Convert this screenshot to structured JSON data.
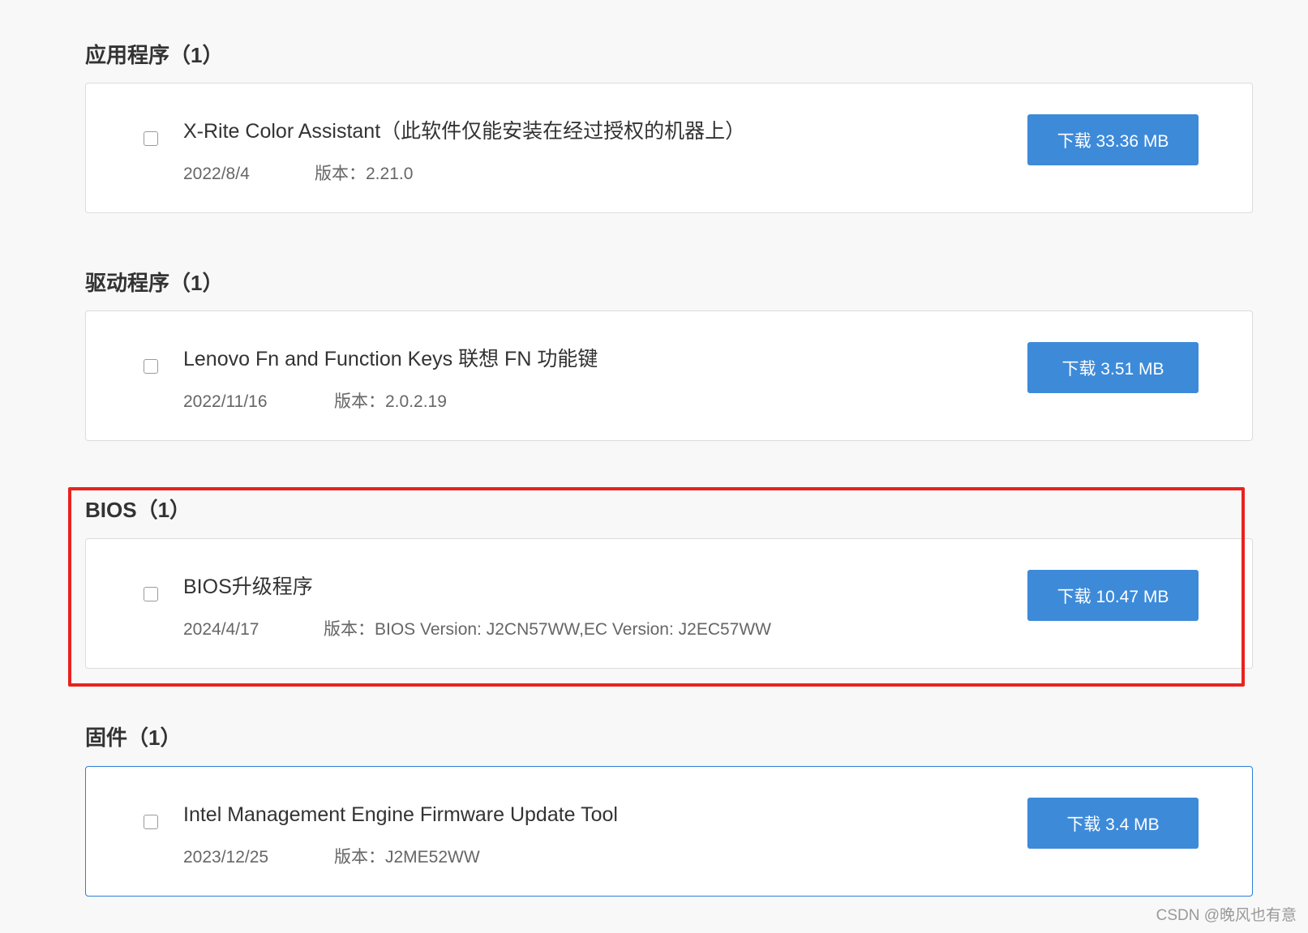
{
  "sections": [
    {
      "title": "应用程序（1）",
      "item": {
        "name": "X-Rite Color Assistant（此软件仅能安装在经过授权的机器上）",
        "date": "2022/8/4",
        "version": "版本：2.21.0",
        "download_label": "下载 33.36 MB"
      }
    },
    {
      "title": "驱动程序（1）",
      "item": {
        "name": "Lenovo Fn and Function Keys 联想 FN 功能键",
        "date": "2022/11/16",
        "version": "版本：2.0.2.19",
        "download_label": "下载 3.51 MB"
      }
    },
    {
      "title": "BIOS（1）",
      "item": {
        "name": "BIOS升级程序",
        "date": "2024/4/17",
        "version": "版本：BIOS Version: J2CN57WW,EC Version: J2EC57WW",
        "download_label": "下载 10.47 MB"
      }
    },
    {
      "title": "固件（1）",
      "item": {
        "name": "Intel Management Engine Firmware Update Tool",
        "date": "2023/12/25",
        "version": "版本：J2ME52WW",
        "download_label": "下载 3.4 MB"
      }
    }
  ],
  "watermark": "CSDN @晚风也有意",
  "colors": {
    "button": "#3d8ad9",
    "highlight_box": "#e8231f",
    "active_card_border": "#2d7fd6",
    "background": "#f8f8f8"
  }
}
